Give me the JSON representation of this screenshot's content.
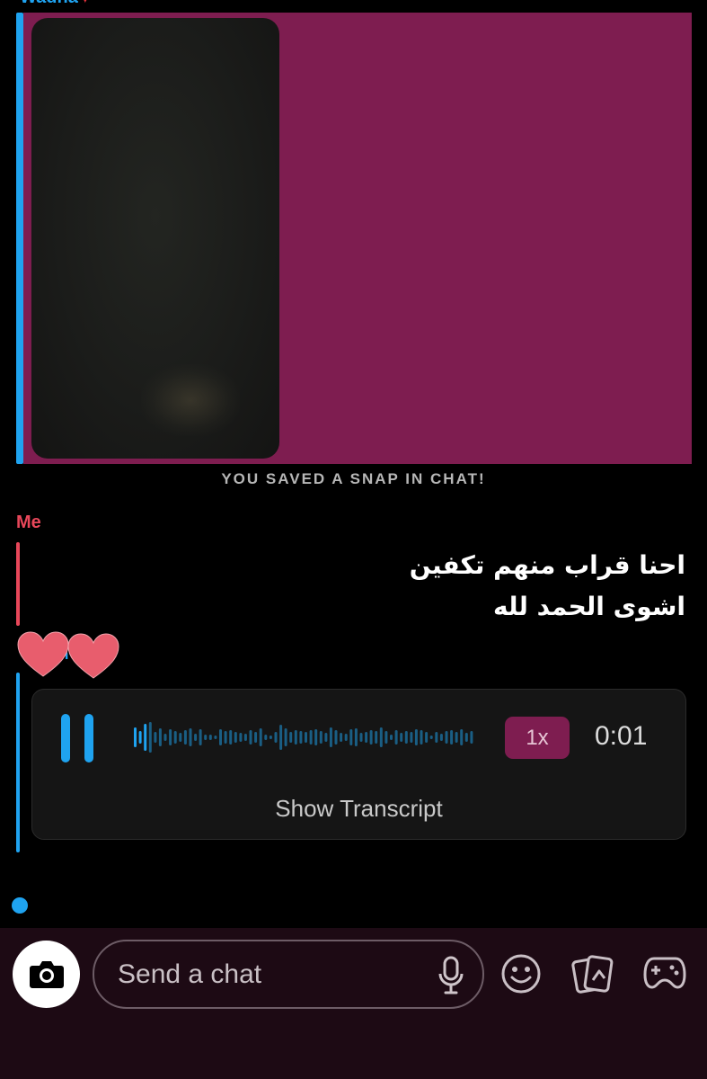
{
  "thread": {
    "top_sender": "Wadha",
    "snap": {
      "saved_note": "YOU SAVED A SNAP IN CHAT!"
    },
    "me_message": {
      "sender": "Me",
      "lines": [
        "احنا قراب منهم تكفين",
        "اشوى الحمد لله"
      ]
    },
    "reaction": {
      "icon": "two-hearts-icon",
      "partial_name": "h"
    },
    "voice_note": {
      "speed_label": "1x",
      "time": "0:01",
      "transcript_label": "Show Transcript",
      "progress": 0.05
    }
  },
  "composer": {
    "placeholder": "Send a chat",
    "icons": [
      "camera-icon",
      "microphone-icon",
      "smiley-icon",
      "memories-icon",
      "games-icon"
    ]
  },
  "colors": {
    "friend_accent": "#1fa3f0",
    "me_accent": "#e8475a",
    "snap_bg": "#7e1d50",
    "composer_bg": "#1d0a14"
  }
}
